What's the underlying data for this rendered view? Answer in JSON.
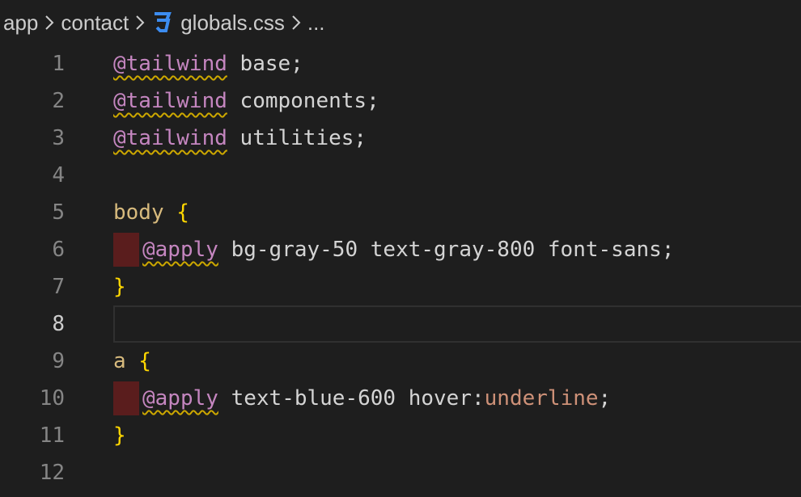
{
  "breadcrumb": {
    "items": [
      "app",
      "contact",
      "globals.css",
      "..."
    ],
    "separator": ">",
    "file_icon": "css3-icon"
  },
  "colors": {
    "background": "#1e1e1e",
    "line_number": "#858585",
    "line_number_active": "#cccccc",
    "at_rule": "#c586c0",
    "selector": "#d7ba7d",
    "brace": "#ffd700",
    "squiggle_warning": "#cca700",
    "indent_error": "#5a1d1d",
    "icon_blue": "#3c8cf0"
  },
  "editor": {
    "active_line": 8,
    "lines": [
      {
        "n": "1",
        "at": "@tailwind",
        "rest": " base;"
      },
      {
        "n": "2",
        "at": "@tailwind",
        "rest": " components;"
      },
      {
        "n": "3",
        "at": "@tailwind",
        "rest": " utilities;"
      },
      {
        "n": "4"
      },
      {
        "n": "5",
        "selector": "body",
        "brace": " {"
      },
      {
        "n": "6",
        "at": "@apply",
        "rest": " bg-gray-50 text-gray-800 font-sans;"
      },
      {
        "n": "7",
        "brace": "}"
      },
      {
        "n": "8"
      },
      {
        "n": "9",
        "selector": "a",
        "brace": " {"
      },
      {
        "n": "10",
        "at": "@apply",
        "rest": " text-blue-600 hover:",
        "value": "underline",
        "end": ";"
      },
      {
        "n": "11",
        "brace": "}"
      },
      {
        "n": "12"
      }
    ]
  }
}
